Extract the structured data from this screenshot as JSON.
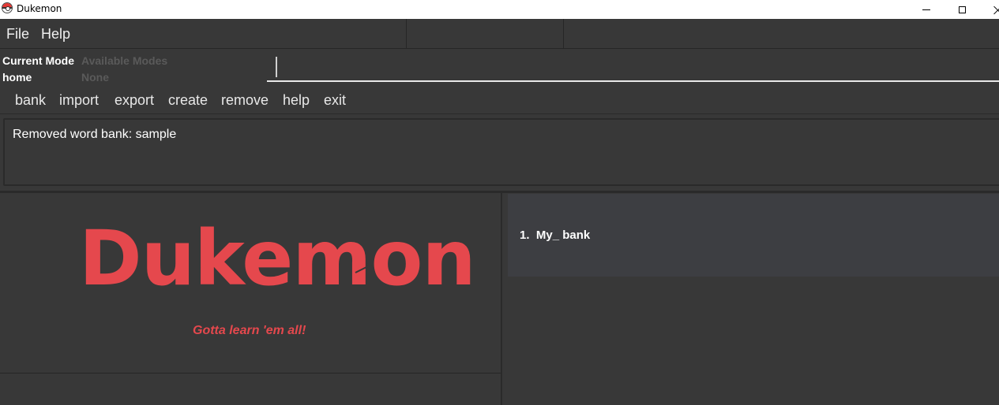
{
  "window": {
    "title": "Dukemon"
  },
  "menu": {
    "file": "File",
    "help": "Help"
  },
  "mode": {
    "current_label": "Current Mode",
    "current_value": "home",
    "available_label": "Available Modes",
    "available_value": "None"
  },
  "command_box": {
    "value": ""
  },
  "commands": [
    "bank",
    "import",
    "export",
    "create",
    "remove",
    "help",
    "exit"
  ],
  "result": {
    "text": "Removed word bank: sample"
  },
  "logo": {
    "text": "Dukemon",
    "tagline": "Gotta learn 'em all!"
  },
  "bank_list": [
    {
      "index": "1.",
      "name": "My_ bank"
    }
  ],
  "colors": {
    "accent": "#e5484d",
    "background": "#383838",
    "card": "#3d3e42"
  }
}
